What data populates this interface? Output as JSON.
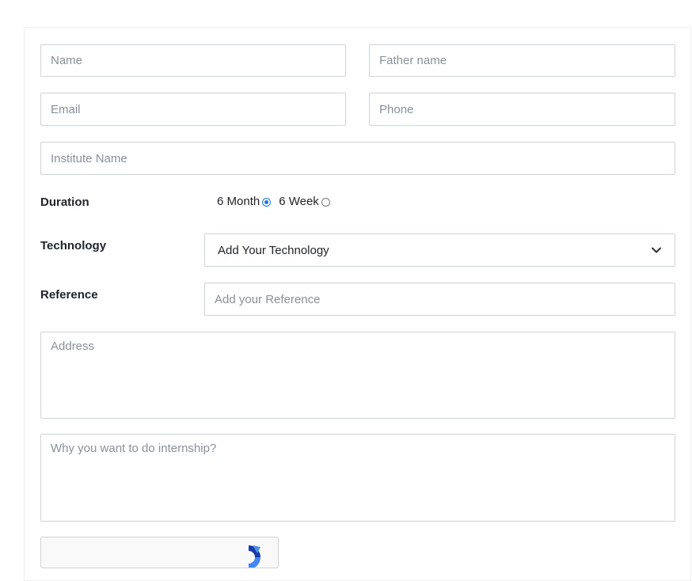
{
  "form": {
    "name_placeholder": "Name",
    "father_name_placeholder": "Father name",
    "email_placeholder": "Email",
    "phone_placeholder": "Phone",
    "institute_placeholder": "Institute Name",
    "duration": {
      "label": "Duration",
      "option_1": "6 Month",
      "option_2": "6 Week",
      "selected": "6 Month"
    },
    "technology": {
      "label": "Technology",
      "selected_value": "Add Your Technology"
    },
    "reference": {
      "label": "Reference",
      "placeholder": "Add your Reference"
    },
    "address_placeholder": "Address",
    "reason_placeholder": "Why you want to do internship?"
  },
  "icons": {
    "dropdown": "chevron-down-icon",
    "captcha": "recaptcha-logo-icon"
  },
  "colors": {
    "border": "#ced4da",
    "placeholder": "#8a9099",
    "radio_accent": "#1a73e8",
    "recaptcha_blue": "#1c3aa9"
  }
}
